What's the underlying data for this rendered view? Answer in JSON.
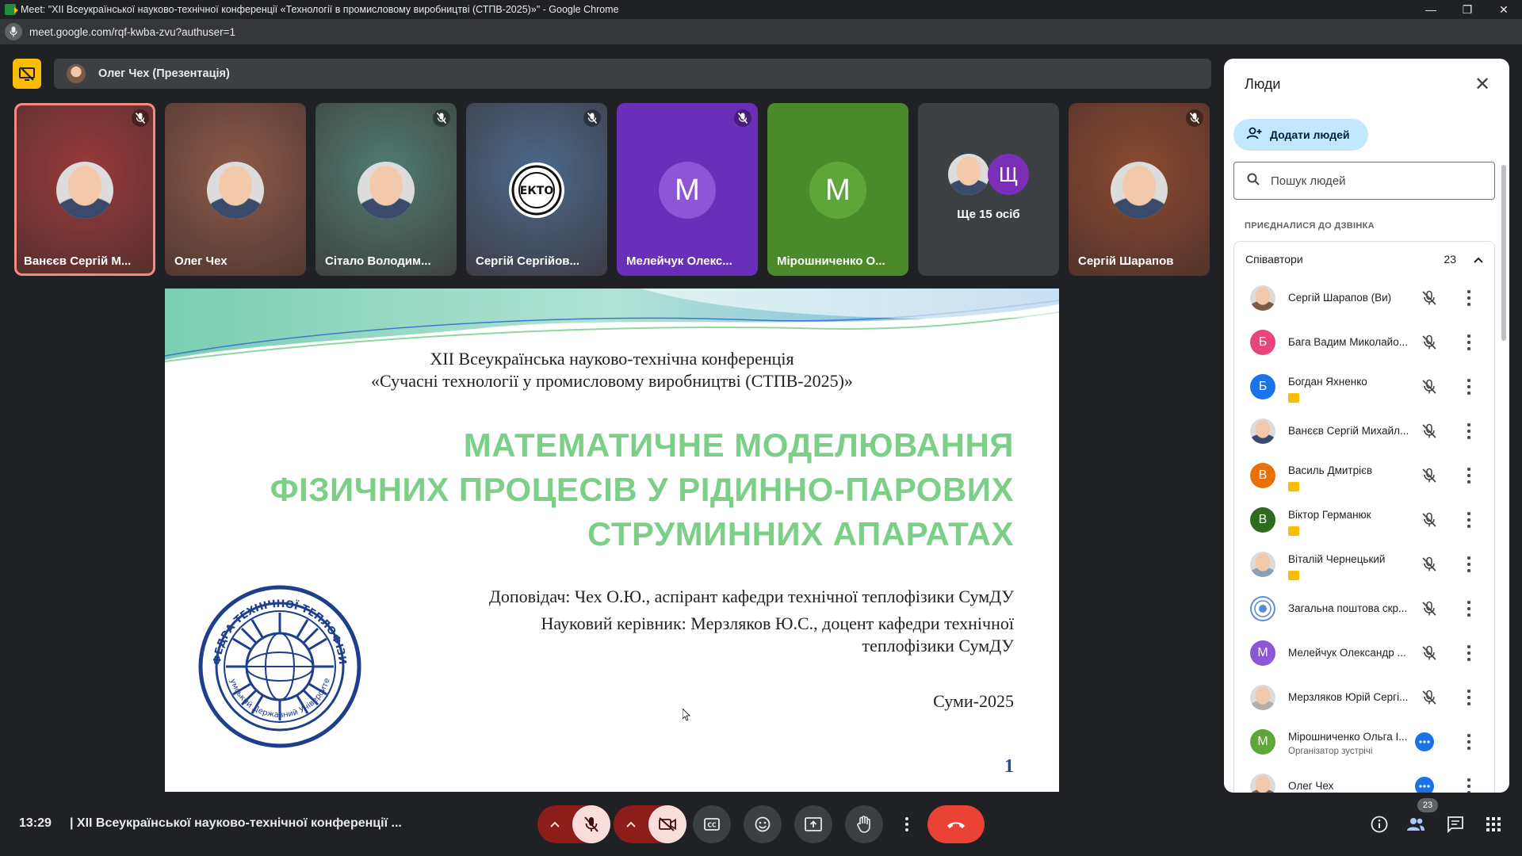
{
  "browser": {
    "window_title": "Meet: \"XII Всеукраїнської науково-технічної конференції «Технології в промисловому виробництві (СТПВ-2025)»\" - Google Chrome",
    "url": "meet.google.com/rqf-kwba-zvu?authuser=1"
  },
  "presentation_bar": {
    "presenter_label": "Олег Чех (Презентація)"
  },
  "tiles": [
    {
      "name": "Ванєєв Сергій М...",
      "muted": true,
      "kind": "photo",
      "bg": "#9a3a3a"
    },
    {
      "name": "Олег Чех",
      "muted": false,
      "kind": "photo",
      "bg": "#8c5a48"
    },
    {
      "name": "Сітало Володим...",
      "muted": true,
      "kind": "photo",
      "bg": "#4e7d72"
    },
    {
      "name": "Сергій Сергійов...",
      "muted": true,
      "kind": "logo",
      "bg": "#4a6a8c"
    },
    {
      "name": "Мелейчук Олекс...",
      "muted": true,
      "kind": "letter",
      "letter": "М",
      "bg": "#6a2fb8",
      "avatar_color": "#8e55d6"
    },
    {
      "name": "Мірошниченко О...",
      "muted": false,
      "kind": "letter",
      "letter": "М",
      "bg": "#4a8a2a",
      "avatar_color": "#5ea63a"
    },
    {
      "more_label": "Ще 15 осіб",
      "kind": "more",
      "letter": "Щ",
      "bg": "#3c4043"
    },
    {
      "name": "Сергій Шарапов",
      "muted": true,
      "kind": "photo",
      "bg": "#8c4a30"
    }
  ],
  "slide": {
    "header_line1": "XII Всеукраїнська науково-технічна конференція",
    "header_line2": "«Сучасні технології у промисловому виробництві (СТПВ-2025)»",
    "title_line1": "МАТЕМАТИЧНЕ МОДЕЛЮВАННЯ",
    "title_line2": "ФІЗИЧНИХ ПРОЦЕСІВ У РІДИННО-ПАРОВИХ",
    "title_line3": "СТРУМИННИХ АПАРАТАХ",
    "speaker": "Доповідач: Чех О.Ю., аспірант кафедри технічної теплофізики СумДУ",
    "advisor_line1": "Науковий керівник: Мерзляков Ю.С., доцент кафедри технічної",
    "advisor_line2": "теплофізики СумДУ",
    "city_year": "Суми-2025",
    "page_number": "1",
    "seal_text_top": "КАФЕДРА ТЕХНІЧНОЇ ТЕПЛОФІЗИКИ",
    "seal_text_bottom": "Сумський Державний Університет"
  },
  "people_panel": {
    "title": "Люди",
    "add_button": "Додати людей",
    "search_placeholder": "Пошук людей",
    "joined_label": "ПРИЄДНАЛИСЯ ДО ДЗВІНКА",
    "group_label": "Співавтори",
    "group_count": "23",
    "people": [
      {
        "name": "Сергій Шарапов (Ви)",
        "avatar": "photo",
        "color": "#7b5a48",
        "presenting": false,
        "state": "muted"
      },
      {
        "name": "Бага Вадим Миколайо...",
        "avatar": "letter",
        "letter": "Б",
        "color": "#e8457a",
        "presenting": false,
        "state": "muted"
      },
      {
        "name": "Богдан Яхненко",
        "avatar": "letter",
        "letter": "Б",
        "color": "#1a73e8",
        "presenting": true,
        "state": "muted"
      },
      {
        "name": "Ванєєв Сергій Михайл...",
        "avatar": "photo",
        "color": "#3a4a6a",
        "presenting": false,
        "state": "muted"
      },
      {
        "name": "Василь Дмитрієв",
        "avatar": "letter",
        "letter": "В",
        "color": "#e8710a",
        "presenting": true,
        "state": "muted"
      },
      {
        "name": "Віктор Германюк",
        "avatar": "letter",
        "letter": "В",
        "color": "#2e6b1f",
        "presenting": true,
        "state": "muted"
      },
      {
        "name": "Віталій Чернецький",
        "avatar": "photo",
        "color": "#8aa0b8",
        "presenting": true,
        "state": "muted"
      },
      {
        "name": "Загальна поштова скр...",
        "avatar": "logo",
        "color": "#5a8ad6",
        "presenting": false,
        "state": "muted"
      },
      {
        "name": "Мелейчук Олександр ...",
        "avatar": "letter",
        "letter": "М",
        "color": "#8e55d6",
        "presenting": false,
        "state": "muted"
      },
      {
        "name": "Мерзляков Юрій Сергі...",
        "avatar": "photo",
        "color": "#b0b0b0",
        "presenting": false,
        "state": "muted"
      },
      {
        "name": "Мірошниченко Ольга І...",
        "avatar": "letter",
        "letter": "М",
        "color": "#5ea63a",
        "presenting": false,
        "state": "speaking",
        "subtitle": "Організатор зустрічі"
      },
      {
        "name": "Олег Чех",
        "avatar": "photo",
        "color": "#7b5a48",
        "presenting": false,
        "state": "speaking"
      }
    ]
  },
  "bottom_bar": {
    "time": "13:29",
    "meeting_name": "XII Всеукраїнської науково-технічної конференції ...",
    "participants_count": "23"
  },
  "icons": {
    "mic_off": "mic-off-icon",
    "cam_off": "camera-off-icon",
    "captions": "captions-icon",
    "emoji": "emoji-icon",
    "present": "present-screen-icon",
    "hand": "raise-hand-icon",
    "more": "more-vert-icon",
    "end": "end-call-icon",
    "info": "info-icon",
    "people": "people-icon",
    "chat": "chat-icon",
    "activities": "activities-icon"
  },
  "colors": {
    "presenting_accent": "#fbbc04",
    "end_call": "#ea4335",
    "muted_red": "#8c1d18",
    "active_speaker_border": "#f28b82",
    "slide_title_green": "#7ccf86"
  }
}
